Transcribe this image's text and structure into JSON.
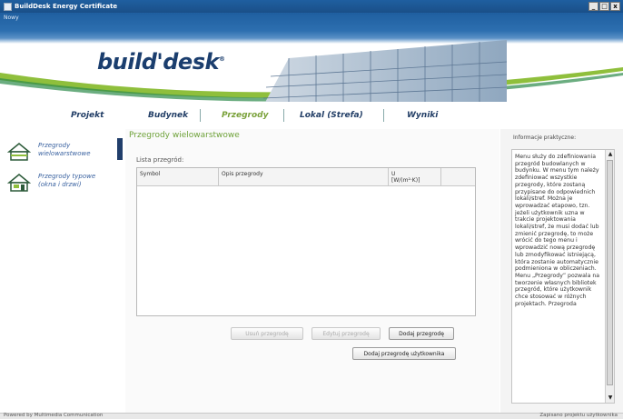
{
  "window": {
    "title": "BuildDesk Energy Certificate",
    "menu": "Nowy"
  },
  "brand": {
    "logo_text": "build'desk",
    "reg": "®"
  },
  "nav": {
    "tabs": [
      {
        "label": "Projekt"
      },
      {
        "label": "Budynek"
      },
      {
        "label": "Przegrody"
      },
      {
        "label": "Lokal (Strefa)"
      },
      {
        "label": "Wyniki"
      }
    ]
  },
  "sidebar": {
    "items": [
      {
        "label": "Przegrody wielowarstwowe",
        "icon": "wall-layers-icon"
      },
      {
        "label": "Przegrody typowe (okna i drzwi)",
        "icon": "window-door-icon"
      }
    ]
  },
  "main": {
    "title": "Przegrody wielowarstwowe",
    "list_label": "Lista przegród:",
    "columns": [
      "Symbol",
      "Opis przegrody",
      "U\n[W/(m²·K)]",
      ""
    ],
    "buttons": {
      "remove": "Usuń przegrodę",
      "edit": "Edytuj przegrodę",
      "add": "Dodaj przegrodę",
      "add_user": "Dodaj przegrodę użytkownika"
    }
  },
  "info": {
    "title": "Informacje praktyczne:",
    "text": "Menu służy do zdefiniowania przegród budowlanych w budynku. W menu tym należy zdefiniować wszystkie przegrody, które zostaną przypisane do odpowiednich lokali/stref. Można je wprowadzać etapowo, tzn. jeżeli użytkownik uzna w trakcie projektowania lokali/stref, że musi dodać lub zmienić przegrodę, to może wrócić do tego menu i wprowadzić nową przegrodę lub zmodyfikować istniejącą, która zostanie automatycznie podmieniona w obliczeniach. Menu „Przegrody” pozwala na tworzenie własnych bibliotek przegród, które użytkownik chce stosować w różnych projektach. Przegroda"
  },
  "status": {
    "left": "Powered by Multimedia Communication",
    "right": "Zapisano projektu użytkownika"
  },
  "colors": {
    "accent_green": "#7aa13a",
    "navy": "#213e6b",
    "title_blue": "#1f5fa0"
  }
}
